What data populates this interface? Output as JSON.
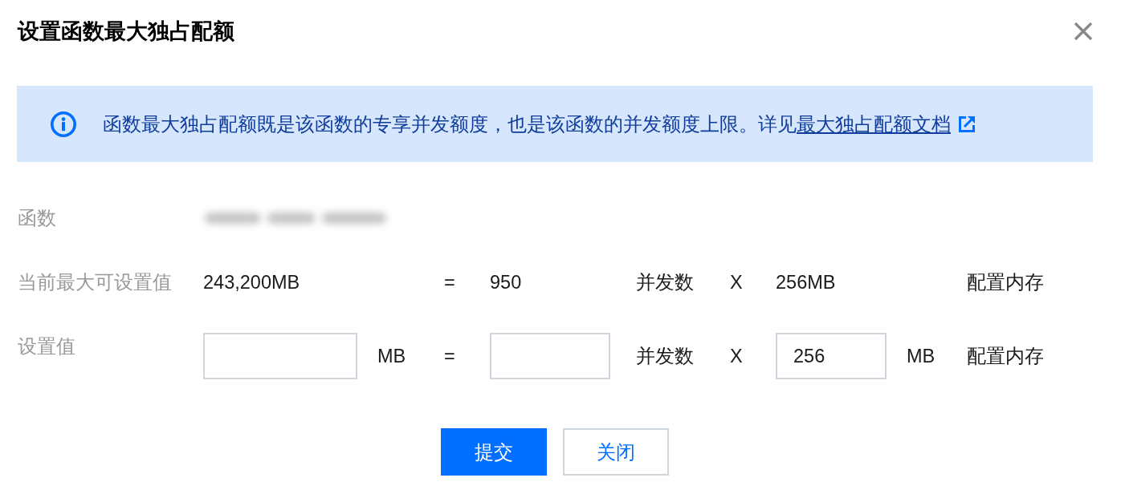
{
  "dialog": {
    "title": "设置函数最大独占配额"
  },
  "notice": {
    "text": "函数最大独占配额既是该函数的专享并发额度，也是该函数的并发额度上限。详见",
    "link": "最大独占配额文档"
  },
  "form": {
    "rows": [
      {
        "kind": "redacted",
        "label": "函数"
      },
      {
        "kind": "reading",
        "label": "当前最大可设置值",
        "total": "243,200MB",
        "equals": "=",
        "concurrency": "950",
        "concurrency_unit": "并发数",
        "times": "X",
        "memory": "256MB",
        "memory_unit": "配置内存"
      },
      {
        "kind": "input",
        "label": "设置值",
        "total_unit": "MB",
        "equals": "=",
        "concurrency_unit": "并发数",
        "times": "X",
        "memory_value": "256",
        "memory_unit": "MB",
        "memory_label": "配置内存"
      }
    ]
  },
  "buttons": [
    {
      "label": "提交",
      "kind": "primary"
    },
    {
      "label": "关闭",
      "kind": "secondary"
    }
  ]
}
